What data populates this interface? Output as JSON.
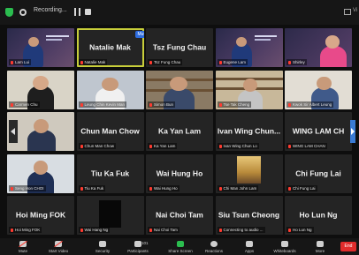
{
  "topbar": {
    "recording_label": "Recording...",
    "view_label": "Vi"
  },
  "participants": [
    {
      "row": 0,
      "col": 0,
      "display": "video",
      "scene": "slide",
      "label": "Lam Lui"
    },
    {
      "row": 0,
      "col": 1,
      "display": "name",
      "name": "Natalie Mak",
      "label": "Natalie Mak",
      "active": true,
      "mute_pill": "Mute"
    },
    {
      "row": 0,
      "col": 2,
      "display": "name",
      "name": "Tsz Fung Chau",
      "label": "Tsz Fung Chau"
    },
    {
      "row": 0,
      "col": 3,
      "display": "video",
      "scene": "slide",
      "label": "Eugene Lam"
    },
    {
      "row": 0,
      "col": 4,
      "display": "video",
      "scene": "slide2",
      "label": "Shirley"
    },
    {
      "row": 1,
      "col": 0,
      "display": "video",
      "scene": "office",
      "label": "Carmen Chu"
    },
    {
      "row": 1,
      "col": 1,
      "display": "video",
      "scene": "office2",
      "label": "Leung Chin Kevin Man"
    },
    {
      "row": 1,
      "col": 2,
      "display": "video",
      "scene": "shelf",
      "label": "Simon Bun"
    },
    {
      "row": 1,
      "col": 3,
      "display": "video",
      "scene": "shelf2",
      "label": "Tse Tak Cheng"
    },
    {
      "row": 1,
      "col": 4,
      "display": "video",
      "scene": "office3",
      "label": "Kwok Sir Albert Leung"
    },
    {
      "row": 2,
      "col": 0,
      "display": "video",
      "scene": "office4",
      "label": ""
    },
    {
      "row": 2,
      "col": 1,
      "display": "name",
      "name": "Chun Man Chow",
      "label": "Chun Man Chow"
    },
    {
      "row": 2,
      "col": 2,
      "display": "name",
      "name": "Ka Yan Lam",
      "label": "Ka Yan Lam"
    },
    {
      "row": 2,
      "col": 3,
      "display": "name",
      "name": "Ivan Wing Chun...",
      "label": "Ivan Wing Chun Lo"
    },
    {
      "row": 2,
      "col": 4,
      "display": "name",
      "name": "WING LAM CH",
      "label": "WING LAM CHAN"
    },
    {
      "row": 3,
      "col": 0,
      "display": "video",
      "scene": "office5",
      "label": "Seng Hon CHOI"
    },
    {
      "row": 3,
      "col": 1,
      "display": "name",
      "name": "Tiu Ka Fuk",
      "label": "Tiu Ka Fuk"
    },
    {
      "row": 3,
      "col": 2,
      "display": "name",
      "name": "Wai Hung Ho",
      "label": "Wai Hung Ho"
    },
    {
      "row": 3,
      "col": 3,
      "display": "video",
      "scene": "poster",
      "label": "Chi Man John Lam"
    },
    {
      "row": 3,
      "col": 4,
      "display": "name",
      "name": "Chi Fung Lai",
      "label": "Chi Fung Lai"
    },
    {
      "row": 4,
      "col": 0,
      "display": "name",
      "name": "Hoi Ming FOK",
      "label": "Hoi Ming FOK"
    },
    {
      "row": 4,
      "col": 1,
      "display": "video",
      "scene": "dark",
      "label": "Wai Hang Ng"
    },
    {
      "row": 4,
      "col": 2,
      "display": "name",
      "name": "Nai Choi Tam",
      "label": "Nai Choi Tam"
    },
    {
      "row": 4,
      "col": 3,
      "display": "name",
      "name": "Siu Tsun Cheong",
      "label": "Connecting to audio ..."
    },
    {
      "row": 4,
      "col": 4,
      "display": "name",
      "name": "Ho Lun Ng",
      "label": "Ho Lun Ng"
    }
  ],
  "toolbar": {
    "items": [
      {
        "label": "Mute",
        "icon": "microphone-icon",
        "muted": true
      },
      {
        "label": "Start Video",
        "icon": "video-camera-icon",
        "muted": true
      },
      {
        "label": "Security",
        "icon": "shield-icon"
      },
      {
        "label": "Participants",
        "icon": "participants-icon",
        "count": "101"
      },
      {
        "label": "Share Screen",
        "icon": "share-screen-icon",
        "green": true
      },
      {
        "label": "Reactions",
        "icon": "smiley-icon"
      },
      {
        "label": "Apps",
        "icon": "apps-icon"
      },
      {
        "label": "Whiteboards",
        "icon": "whiteboard-icon"
      },
      {
        "label": "More",
        "icon": "more-icon"
      }
    ],
    "end_label": "End"
  },
  "colors": {
    "active_border": "#c8ce3a",
    "mic_muted": "#ff3b30",
    "share_green": "#2bbd4f",
    "end_red": "#e02c2c",
    "tile_bg": "#242424"
  }
}
